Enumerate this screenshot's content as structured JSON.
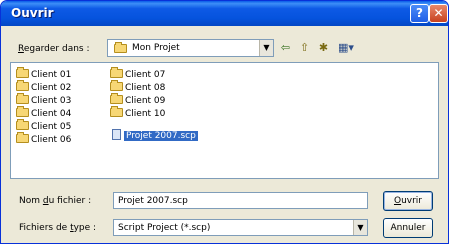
{
  "window": {
    "title": "Ouvrir",
    "help_label": "?",
    "close_label": "✕"
  },
  "look_in": {
    "label": "Regarder dans :",
    "value": "Mon Projet"
  },
  "toolbar": {
    "icons": [
      "back-icon",
      "up-folder-icon",
      "new-folder-icon",
      "view-menu-icon"
    ]
  },
  "files": {
    "column1": [
      "Client 01",
      "Client 02",
      "Client 03",
      "Client 04",
      "Client 05",
      "Client 06"
    ],
    "column2": [
      "Client 07",
      "Client 08",
      "Client 09",
      "Client 10"
    ],
    "selected_file": "Projet 2007.scp"
  },
  "filename": {
    "label": "Nom du fichier :",
    "value": "Projet 2007.scp"
  },
  "filetype": {
    "label": "Fichiers de type :",
    "value": "Script Project (*.scp)"
  },
  "buttons": {
    "open": "Ouvrir",
    "cancel": "Annuler"
  }
}
